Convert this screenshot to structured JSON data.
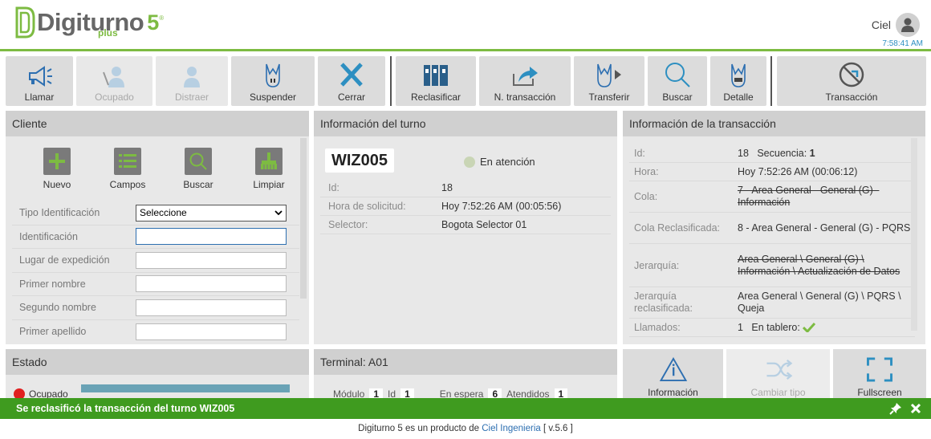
{
  "header": {
    "logo_text": "Digiturno",
    "logo_version": "5",
    "logo_reg": "®",
    "logo_plus": "plus",
    "user_name": "Ciel",
    "clock": "7:58:41 AM"
  },
  "toolbar": [
    {
      "label": "Llamar",
      "icon": "megaphone-icon",
      "enabled": true
    },
    {
      "label": "Ocupado",
      "icon": "busy-user-icon",
      "enabled": false
    },
    {
      "label": "Distraer",
      "icon": "distract-user-icon",
      "enabled": false
    },
    {
      "label": "Suspender",
      "icon": "suspend-icon",
      "enabled": true
    },
    {
      "label": "Cerrar",
      "icon": "close-icon",
      "enabled": true
    },
    {
      "label": "Reclasificar",
      "icon": "binders-icon",
      "enabled": true
    },
    {
      "label": "N. transacción",
      "icon": "new-transaction-icon",
      "enabled": true
    },
    {
      "label": "Transferir",
      "icon": "transfer-icon",
      "enabled": true
    },
    {
      "label": "Buscar",
      "icon": "search-icon",
      "enabled": true
    },
    {
      "label": "Detalle",
      "icon": "detail-icon",
      "enabled": true
    },
    {
      "label": "Transacción",
      "icon": "no-transaction-icon",
      "enabled": true
    }
  ],
  "cliente": {
    "title": "Cliente",
    "buttons": [
      {
        "label": "Nuevo",
        "icon": "plus-icon"
      },
      {
        "label": "Campos",
        "icon": "list-icon"
      },
      {
        "label": "Buscar",
        "icon": "search-icon"
      },
      {
        "label": "Limpiar",
        "icon": "broom-icon"
      }
    ],
    "fields": [
      {
        "label": "Tipo Identificación",
        "value": "Seleccione",
        "type": "select"
      },
      {
        "label": "Identificación",
        "value": "",
        "type": "input"
      },
      {
        "label": "Lugar de expedición",
        "value": "",
        "type": "input"
      },
      {
        "label": "Primer nombre",
        "value": "",
        "type": "input"
      },
      {
        "label": "Segundo nombre",
        "value": "",
        "type": "input"
      },
      {
        "label": "Primer apellido",
        "value": "",
        "type": "input"
      }
    ]
  },
  "turno": {
    "title": "Información del turno",
    "code": "WIZ005",
    "state": "En atención",
    "rows": [
      {
        "k": "Id:",
        "v": "18"
      },
      {
        "k": "Hora de solicitud:",
        "v": "Hoy 7:52:26 AM (00:05:56)"
      },
      {
        "k": "Selector:",
        "v": "Bogota Selector 01"
      }
    ]
  },
  "transaccion": {
    "title": "Información de la transacción",
    "id_label": "Id:",
    "id_value": "18",
    "seq_label": "Secuencia:",
    "seq_value": "1",
    "hora_label": "Hora:",
    "hora_value": "Hoy 7:52:26 AM (00:06:12)",
    "cola_label": "Cola:",
    "cola_value": "7 - Area General - General (G) - Información",
    "cola_re_label": "Cola Reclasificada:",
    "cola_re_value": "8 - Area General - General (G) - PQRS",
    "jer_label": "Jerarquía:",
    "jer_value": "Area General \\ General (G) \\ Información \\ Actualización de Datos",
    "jer_re_label": "Jerarquía reclasificada:",
    "jer_re_value": "Area General \\ General (G) \\ PQRS \\ Queja",
    "llam_label": "Llamados:",
    "llam_value": "1",
    "tablero_label": "En tablero:"
  },
  "estado": {
    "title": "Estado",
    "status": "Ocupado",
    "status_color": "#e02020"
  },
  "terminal": {
    "title": "Terminal: A01",
    "modulo_label": "Módulo",
    "modulo_value": "1",
    "id_label": "Id",
    "id_value": "1",
    "espera_label": "En espera",
    "espera_value": "6",
    "atendidos_label": "Atendidos",
    "atendidos_value": "1"
  },
  "side_buttons": [
    {
      "label": "Información",
      "icon": "info-icon",
      "enabled": true
    },
    {
      "label": "Cambiar tipo",
      "icon": "shuffle-icon",
      "enabled": false
    },
    {
      "label": "Fullscreen",
      "icon": "fullscreen-icon",
      "enabled": true
    }
  ],
  "toast": {
    "text": "Se reclasificó la transacción del turno ",
    "turno": "WIZ005"
  },
  "footer": {
    "prefix": "Digiturno 5 es un producto de ",
    "link": "Ciel Ingenieria",
    "suffix": " [ v.5.6 ]"
  },
  "colors": {
    "accent": "#7dbb42",
    "toast": "#3f9b1f",
    "link": "#2d6fb1"
  }
}
